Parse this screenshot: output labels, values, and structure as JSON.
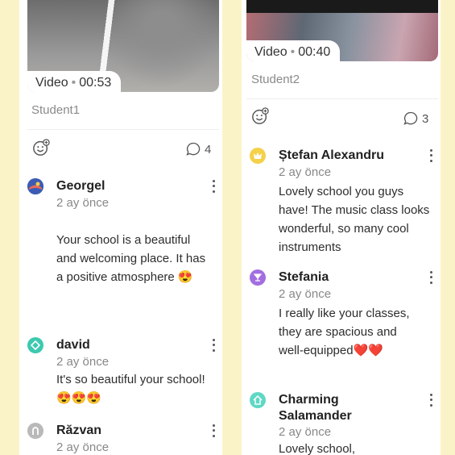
{
  "left": {
    "video": {
      "label": "Video",
      "duration": "00:53"
    },
    "student": "Student1",
    "comment_count": "4",
    "comments": [
      {
        "name": "Georgel",
        "time": "2 ay önce",
        "text": " Your  school is a beautiful and welcoming place. It has a positive atmosphere 😍"
      },
      {
        "name": "david",
        "time": "2 ay önce",
        "text": "It's so beautiful your school!😍😍😍"
      },
      {
        "name": "Răzvan",
        "time": "2 ay önce",
        "text": ""
      }
    ]
  },
  "right": {
    "video": {
      "label": "Video",
      "duration": "00:40"
    },
    "student": "Student2",
    "comment_count": "3",
    "comments": [
      {
        "name": "Ștefan Alexandru",
        "time": "2 ay önce",
        "text": "Lovely school you guys have! The music class looks wonderful, so many cool instruments"
      },
      {
        "name": "Stefania",
        "time": "2 ay önce",
        "text": "I really like your classes, they are spacious and well-equipped❤️❤️"
      },
      {
        "name": "Charming Salamander",
        "time": "2 ay önce",
        "text": "Lovely school,"
      }
    ]
  },
  "colors": {
    "accent_stripe": "#fbf3c8",
    "avatar_georgel": "#3b5bb5",
    "avatar_david": "#3cc9b0",
    "avatar_razvan": "#b9b9b9",
    "avatar_stefan": "#f5d14a",
    "avatar_stefania": "#a36ee0",
    "avatar_charming": "#5fd8c4"
  }
}
